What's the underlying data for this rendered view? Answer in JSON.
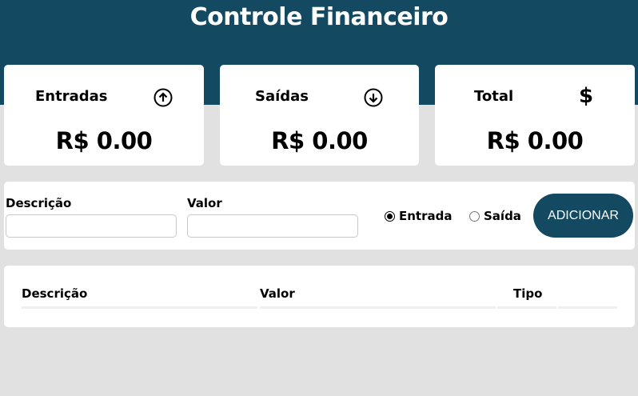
{
  "header": {
    "title": "Controle Financeiro",
    "bg_color": "#134a61"
  },
  "cards": [
    {
      "label": "Entradas",
      "icon": "arrow-up-circle-icon",
      "value": "R$ 0.00"
    },
    {
      "label": "Saídas",
      "icon": "arrow-down-circle-icon",
      "value": "R$ 0.00"
    },
    {
      "label": "Total",
      "icon": "dollar-sign-icon",
      "icon_text": "$",
      "value": "R$ 0.00"
    }
  ],
  "form": {
    "description_label": "Descrição",
    "description_value": "",
    "value_label": "Valor",
    "value_value": "",
    "radio_entrada_label": "Entrada",
    "radio_saida_label": "Saída",
    "selected_type": "Entrada",
    "add_button_label": "ADICIONAR"
  },
  "table": {
    "columns": [
      "Descrição",
      "Valor",
      "Tipo",
      ""
    ],
    "rows": []
  }
}
